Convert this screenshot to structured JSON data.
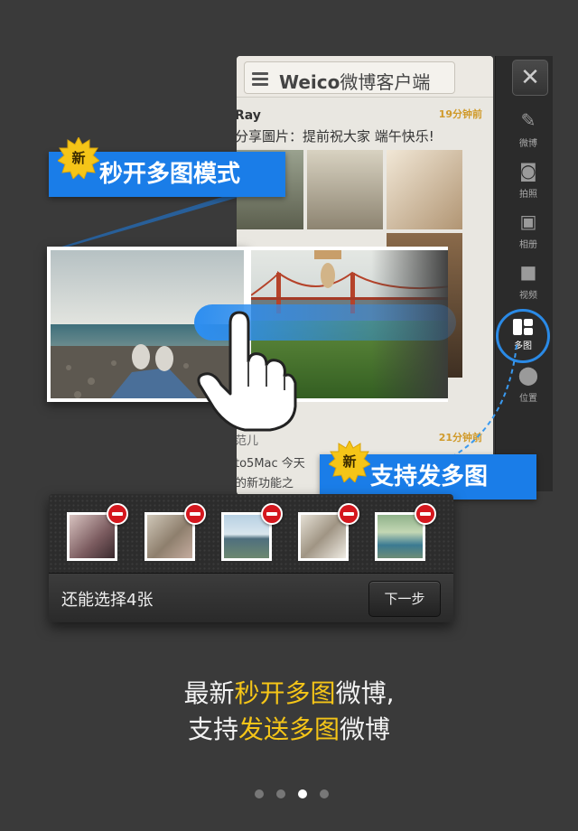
{
  "feed": {
    "app_title": "Weico",
    "app_title_cn": "微博客户端",
    "post1_user": "Ray",
    "post1_time": "19分钟前",
    "post1_text": "分享圖片：提前祝大家 端午快乐!",
    "post2_user": "范儿",
    "post2_time": "21分钟前",
    "post2_text": "to5Mac 今天",
    "post2_text2": "的新功能之"
  },
  "sidebar": {
    "items": [
      {
        "label": "微博",
        "icon": "pen-icon"
      },
      {
        "label": "拍照",
        "icon": "camera-icon"
      },
      {
        "label": "相册",
        "icon": "album-icon"
      },
      {
        "label": "视频",
        "icon": "video-icon"
      },
      {
        "label": "多图",
        "icon": "multi-image-icon"
      },
      {
        "label": "位置",
        "icon": "location-pin-icon"
      }
    ]
  },
  "labels": {
    "new_badge": "新",
    "feature_a": "秒开多图模式",
    "feature_b": "支持发多图"
  },
  "tray": {
    "remaining_text": "还能选择4张",
    "next_button": "下一步"
  },
  "caption": {
    "line1_a": "最新",
    "line1_hl": "秒开多图",
    "line1_b": "微博,",
    "line2_a": "支持",
    "line2_hl": "发送多图",
    "line2_b": "微博"
  },
  "pager": {
    "count": 4,
    "active": 3
  },
  "colors": {
    "accent_blue": "#1a7de8",
    "highlight_yellow": "#f5c518",
    "remove_red": "#d4171e",
    "time_orange": "#d09a2a"
  }
}
